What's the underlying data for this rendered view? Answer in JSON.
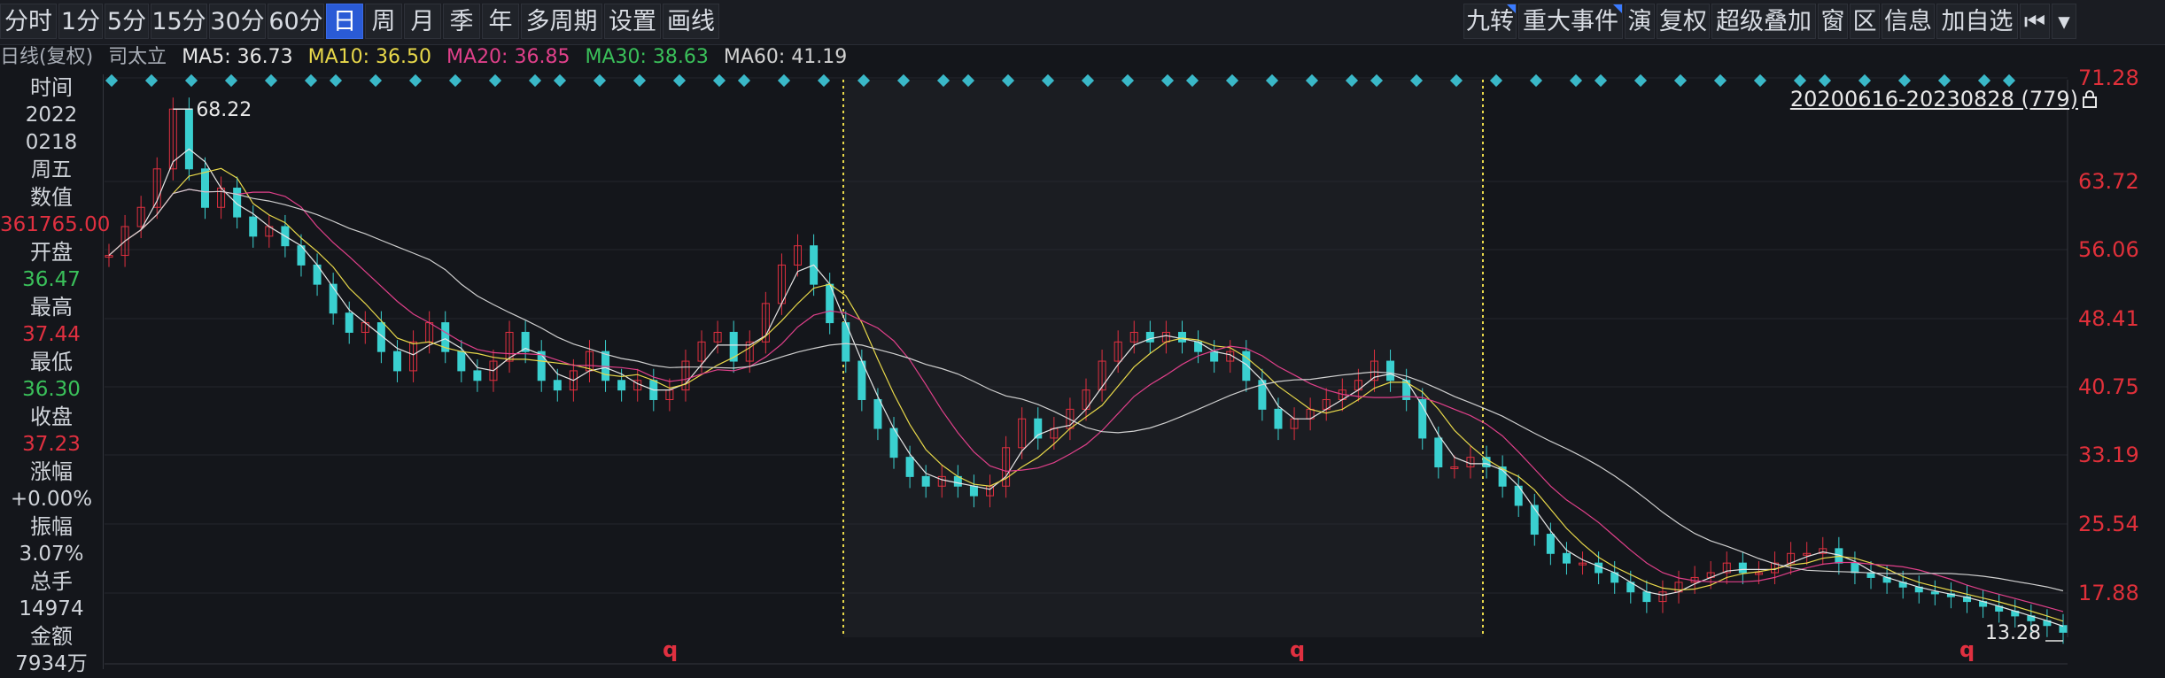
{
  "toolbar": {
    "periods": [
      "分时",
      "1分",
      "5分",
      "15分",
      "30分",
      "60分",
      "日",
      "周",
      "月",
      "季",
      "年",
      "多周期",
      "设置",
      "画线"
    ],
    "active": "日",
    "right_items": [
      "九转",
      "重大事件",
      "演",
      "复权",
      "超级叠加",
      "窗",
      "区",
      "信息",
      "加自选"
    ]
  },
  "indicators": {
    "chart_label": "日线(复权)",
    "stock_name": "司太立",
    "ma5": "MA5: 36.73",
    "ma10": "MA10: 36.50",
    "ma20": "MA20: 36.85",
    "ma30": "MA30: 38.63",
    "ma60": "MA60: 41.19"
  },
  "colors": {
    "ma5": "#e6e6e6",
    "ma10": "#e8d84a",
    "ma20": "#e0408a",
    "ma30": "#3ac05a",
    "ma60": "#d0d0d0",
    "up": "#e03040",
    "down": "#3ad0d0",
    "axis_red": "#e0303a"
  },
  "info_panel": [
    {
      "label": "时间",
      "value": "2022",
      "color": "#d0d4da"
    },
    {
      "label": "",
      "value": "0218",
      "color": "#d0d4da"
    },
    {
      "label": "",
      "value": "周五",
      "color": "#d0d4da"
    },
    {
      "label": "数值",
      "value": "361765.00",
      "color": "#e03040"
    },
    {
      "label": "开盘",
      "value": "36.47",
      "color": "#3ac05a"
    },
    {
      "label": "最高",
      "value": "37.44",
      "color": "#e03040"
    },
    {
      "label": "最低",
      "value": "36.30",
      "color": "#3ac05a"
    },
    {
      "label": "收盘",
      "value": "37.23",
      "color": "#e03040"
    },
    {
      "label": "涨幅",
      "value": "+0.00%",
      "color": "#d0d4da"
    },
    {
      "label": "振幅",
      "value": "3.07%",
      "color": "#d0d4da"
    },
    {
      "label": "总手",
      "value": "14974",
      "color": "#d0d4da"
    },
    {
      "label": "金额",
      "value": "7934万",
      "color": "#d0d4da"
    }
  ],
  "range_label": "20200616-20230828 (779)",
  "chart_data": {
    "type": "candlestick",
    "y_ticks": [
      "71.28",
      "63.72",
      "56.06",
      "48.41",
      "40.75",
      "33.19",
      "25.54",
      "17.88"
    ],
    "ylim": [
      13.28,
      71.28
    ],
    "max_label": "68.22",
    "min_label": "13.28",
    "q_markers": 3,
    "closes": [
      53,
      56,
      58,
      62,
      68.22,
      62,
      58,
      60,
      57,
      55,
      56,
      54,
      52,
      50,
      47,
      45,
      46,
      43,
      41,
      44,
      46,
      43,
      41,
      40,
      42,
      45,
      43,
      40,
      39,
      41,
      43,
      40,
      39,
      40,
      38,
      39,
      42,
      44,
      45,
      42,
      44,
      48,
      52,
      54,
      50,
      46,
      42,
      38,
      35,
      32,
      30,
      29,
      30,
      29,
      28,
      29,
      33,
      36,
      34,
      35,
      37,
      39,
      42,
      44,
      45,
      44,
      45,
      44,
      43,
      42,
      43,
      40,
      37,
      35,
      36,
      37,
      38,
      39,
      40,
      42,
      40,
      38,
      34,
      31,
      31,
      32,
      31,
      29,
      27,
      24,
      22,
      21,
      21,
      20,
      19,
      18,
      17,
      18,
      19,
      19.5,
      20,
      21,
      20,
      20,
      21,
      22,
      22,
      22.5,
      21,
      20,
      19.5,
      19,
      18.5,
      18,
      17.8,
      17.5,
      17,
      16.5,
      16,
      15.5,
      15,
      14.5,
      13.8
    ]
  }
}
